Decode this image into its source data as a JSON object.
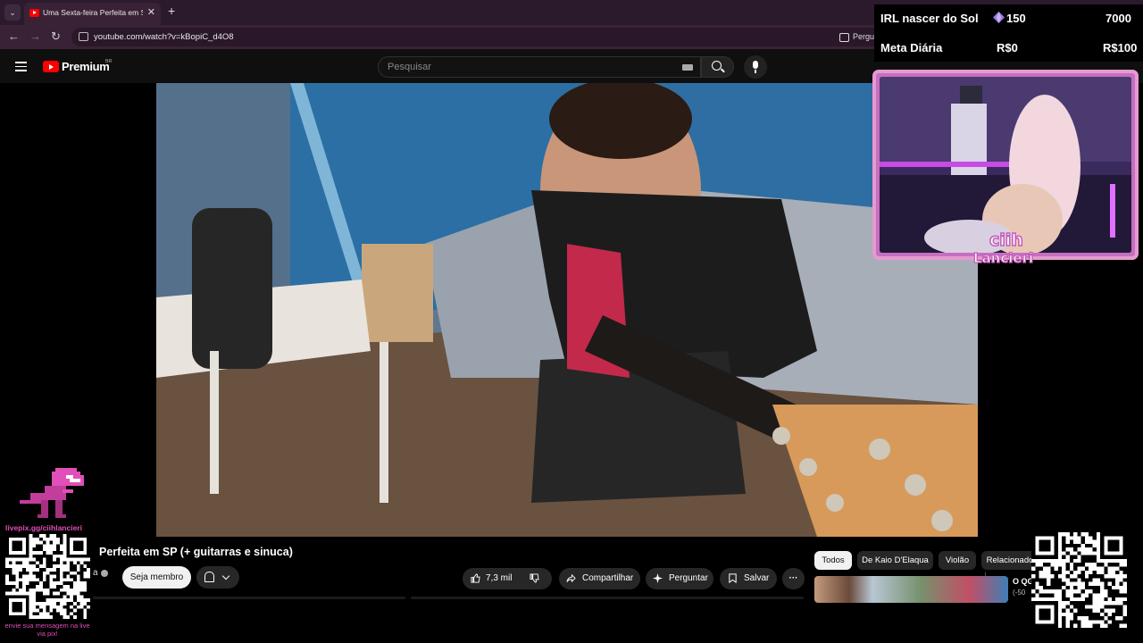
{
  "browser": {
    "tab_title": "Uma Sexta-feira Perfeita em SP",
    "tab_close": "✕",
    "new_tab": "+",
    "url": "youtube.com/watch?v=kBopiC_d4O8",
    "back": "←",
    "forward": "→",
    "reload": "↻",
    "chip_label": "Pergu"
  },
  "youtube": {
    "logo_text": "Premium",
    "region": "BR",
    "search_placeholder": "Pesquisar"
  },
  "video": {
    "title": "Perfeita em SP (+ guitarras e sinuca)",
    "channel_fragment": "a",
    "join_label": "Seja membro",
    "like_count": "7,3 mil",
    "share_label": "Compartilhar",
    "ask_label": "Perguntar",
    "save_label": "Salvar",
    "more_label": "···"
  },
  "chips": [
    "Todos",
    "De Kaio D'Elaqua",
    "Violão",
    "Relacionado"
  ],
  "recommendation": {
    "title_fragment": "O QG",
    "sub_fragment": "(-50"
  },
  "overlay": {
    "goal_name": "IRL nascer do Sol",
    "goal_current": "150",
    "goal_target": "7000",
    "daily_label": "Meta Diária",
    "daily_current": "R$0",
    "daily_target": "R$100",
    "streamer_name_line1": "ciih",
    "streamer_name_line2": "Lancieri",
    "livepix_url": "livepix.gg/ciihlancieri",
    "livepix_message": "envie sua mensagem na live via pix!"
  },
  "colors": {
    "accent_pink": "#e14fb8",
    "youtube_red": "#ff0000",
    "cam_border": "#e69ad0"
  }
}
